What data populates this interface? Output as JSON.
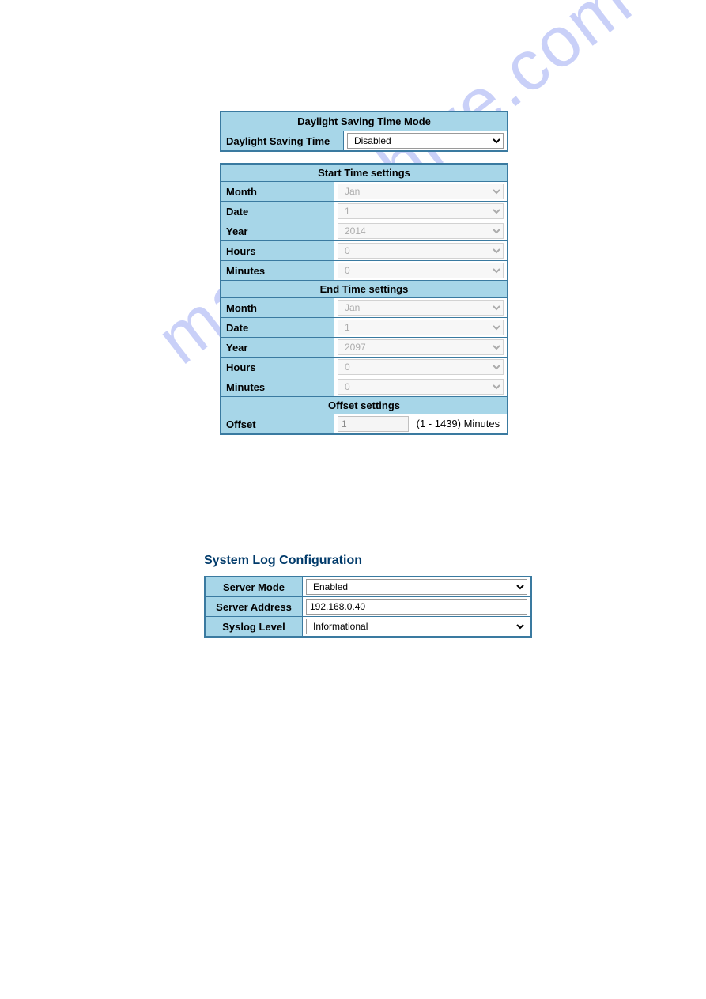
{
  "dst": {
    "header": "Daylight Saving Time Mode",
    "mode_label": "Daylight Saving Time",
    "mode_value": "Disabled",
    "start_header": "Start Time settings",
    "end_header": "End Time settings",
    "offset_header": "Offset settings",
    "start": {
      "month_label": "Month",
      "month_value": "Jan",
      "date_label": "Date",
      "date_value": "1",
      "year_label": "Year",
      "year_value": "2014",
      "hours_label": "Hours",
      "hours_value": "0",
      "minutes_label": "Minutes",
      "minutes_value": "0"
    },
    "end": {
      "month_label": "Month",
      "month_value": "Jan",
      "date_label": "Date",
      "date_value": "1",
      "year_label": "Year",
      "year_value": "2097",
      "hours_label": "Hours",
      "hours_value": "0",
      "minutes_label": "Minutes",
      "minutes_value": "0"
    },
    "offset": {
      "label": "Offset",
      "value": "1",
      "hint": "(1 - 1439) Minutes"
    }
  },
  "syslog": {
    "title": "System Log Configuration",
    "mode_label": "Server Mode",
    "mode_value": "Enabled",
    "address_label": "Server Address",
    "address_value": "192.168.0.40",
    "level_label": "Syslog Level",
    "level_value": "Informational"
  },
  "watermark": "manualshive.com"
}
